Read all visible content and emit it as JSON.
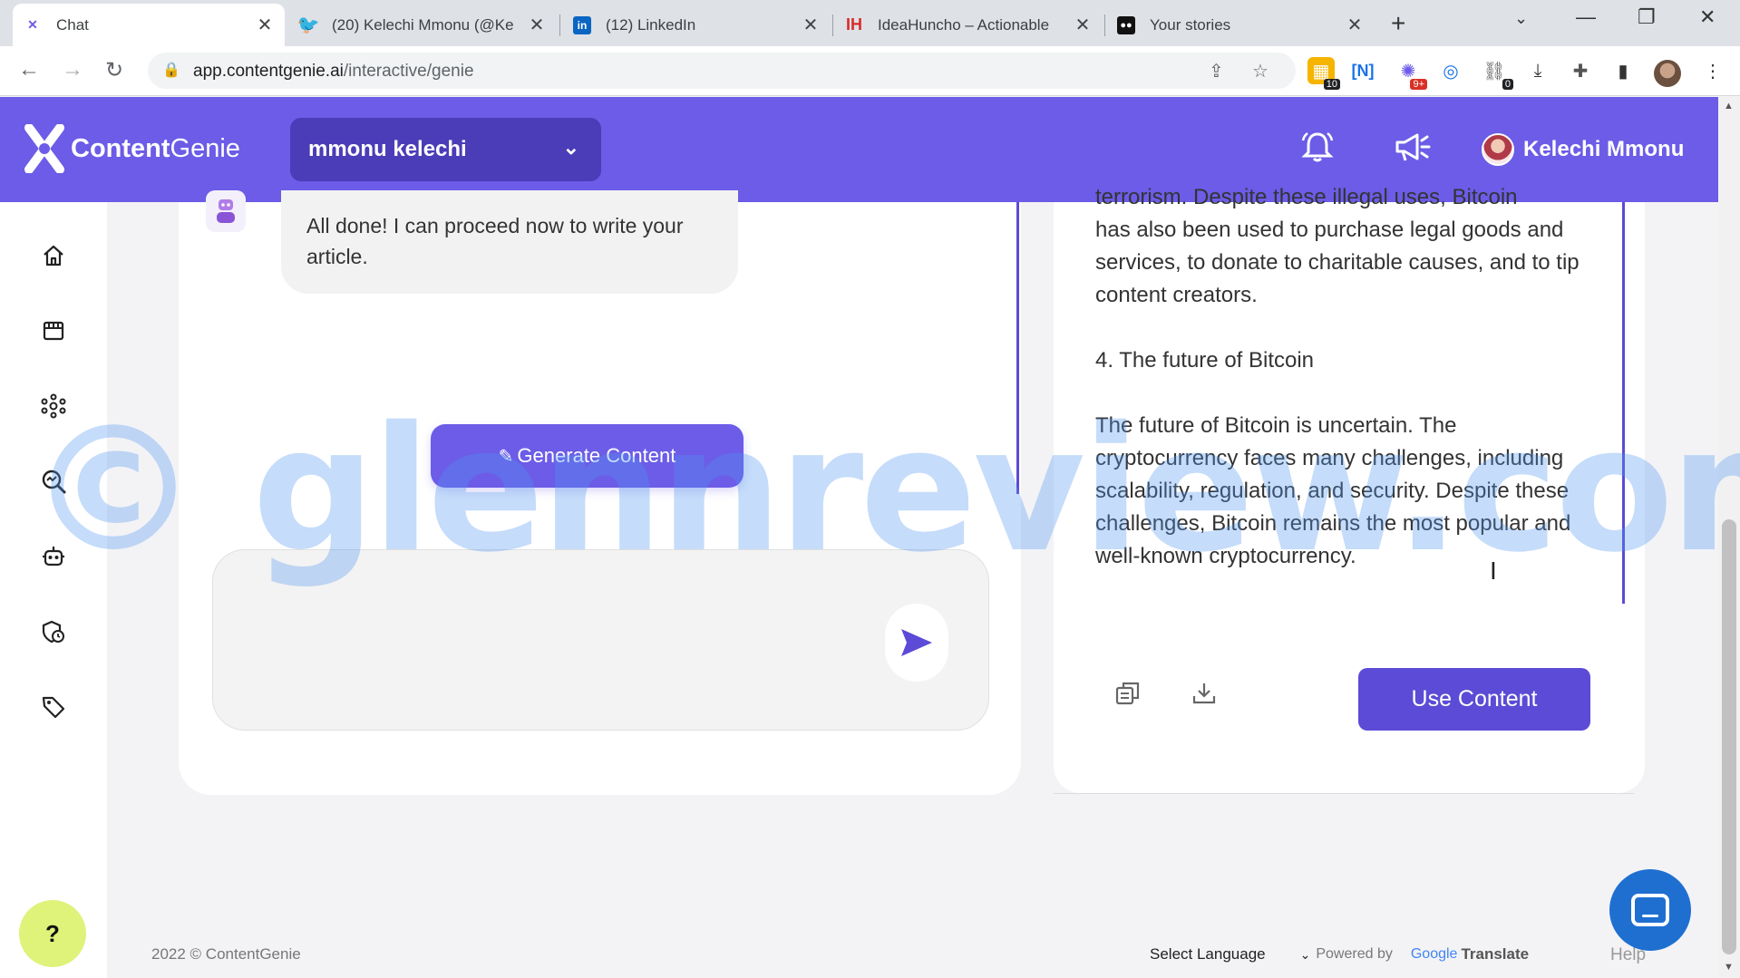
{
  "browser": {
    "tabs": [
      {
        "label": "Chat",
        "icon": "contentgenie-tab-icon"
      },
      {
        "label": "(20) Kelechi Mmonu (@Ke",
        "icon": "twitter-icon"
      },
      {
        "label": "(12) LinkedIn",
        "icon": "linkedin-icon"
      },
      {
        "label": "IdeaHuncho – Actionable",
        "icon": "ideahuncho-icon"
      },
      {
        "label": "Your stories",
        "icon": "medium-icon"
      }
    ],
    "url_host": "app.contentgenie.ai",
    "url_path": "/interactive/genie",
    "extension_badges": [
      "10",
      "9+",
      "0"
    ]
  },
  "header": {
    "logo_bold": "Content",
    "logo_light": "Genie",
    "org_selected": "mmonu kelechi",
    "user_name": "Kelechi Mmonu",
    "accent_color": "#6c5ce7"
  },
  "chat": {
    "bot_message": "All done! I can proceed now to write your article.",
    "generate_label": "Generate Content",
    "input_value": ""
  },
  "article": {
    "partial_top": "terrorism. Despite these illegal uses, Bitcoin",
    "para1": "has also been used to purchase legal goods and services, to donate to charitable causes, and to tip content creators.",
    "heading": "4. The future of Bitcoin",
    "para2": "The future of Bitcoin is uncertain. The cryptocurrency faces many challenges, including scalability, regulation, and security. Despite these challenges, Bitcoin remains the most popular and well-known cryptocurrency."
  },
  "actions": {
    "use_content_label": "Use Content"
  },
  "footer": {
    "copyright": "2022 © ContentGenie",
    "select_language": "Select Language",
    "powered_by": "Powered by",
    "google": "Google",
    "translate": "Translate",
    "help": "Help",
    "help_button": "?"
  },
  "watermark": "© glennreview.com"
}
